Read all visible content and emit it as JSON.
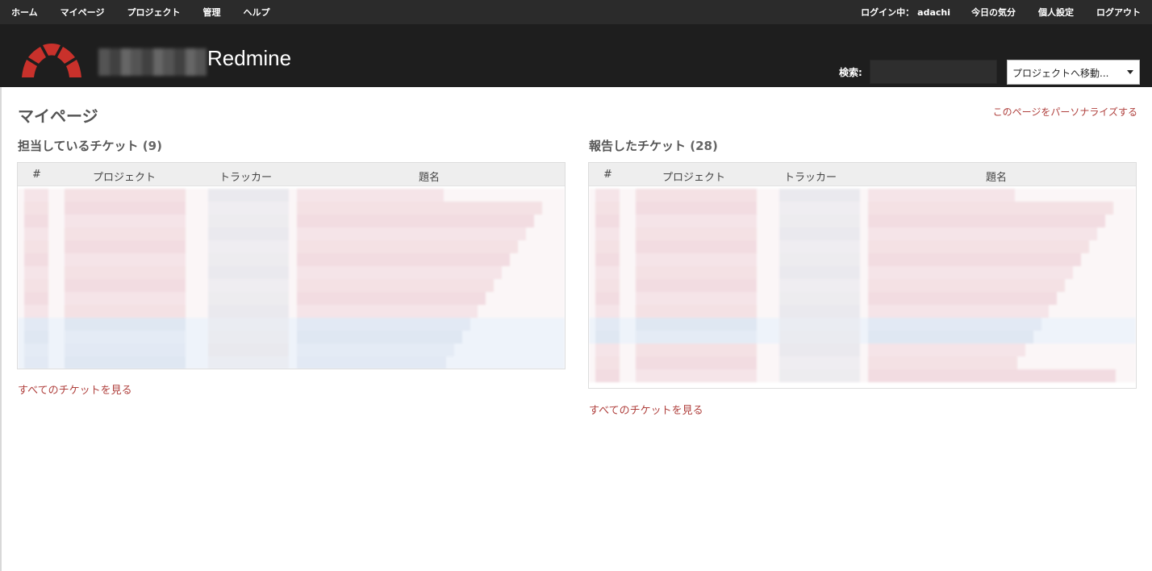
{
  "top_menu": {
    "items": [
      "ホーム",
      "マイページ",
      "プロジェクト",
      "管理",
      "ヘルプ"
    ],
    "login_label": "ログイン中：",
    "login_user": "adachi",
    "right_items": [
      "今日の気分",
      "個人設定",
      "ログアウト"
    ]
  },
  "header": {
    "site_title": "Redmine",
    "search_label": "検索:",
    "search_value": "",
    "project_jump": "プロジェクトへ移動..."
  },
  "page": {
    "title": "マイページ",
    "personalize_link": "このページをパーソナライズする"
  },
  "assigned": {
    "title": "担当しているチケット",
    "count": "(9)",
    "columns": [
      "#",
      "プロジェクト",
      "トラッカー",
      "題名"
    ],
    "all_link": "すべてのチケットを見る"
  },
  "reported": {
    "title": "報告したチケット",
    "count": "(28)",
    "columns": [
      "#",
      "プロジェクト",
      "トラッカー",
      "題名"
    ],
    "all_link": "すべてのチケットを見る"
  },
  "colors": {
    "link": "#b0413e",
    "top_menu_bg": "#2b2b2b",
    "header_bg": "#1e1e1e",
    "logo": "#c9312b",
    "row_pink": "#f1d9de",
    "row_blue": "#dde6f1"
  },
  "icons": {
    "logo": "redmine-logo-icon",
    "select_caret": "chevron-down-icon"
  }
}
